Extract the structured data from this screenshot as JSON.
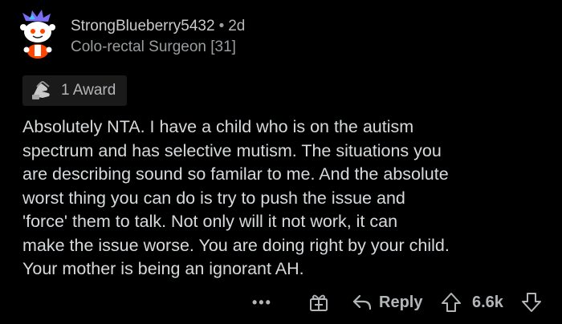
{
  "comment": {
    "username": "StrongBlueberry5432",
    "separator": "•",
    "age": "2d",
    "flair": "Colo-rectal Surgeon [31]",
    "award_count_label": "1 Award",
    "body_lines": [
      "Absolutely NTA. I have a child who is on the autism",
      "spectrum and has selective mutism. The situations you",
      "are describing sound so familar to me. And the absolute",
      "worst thing you can do is try to push the issue and",
      "'force' them to talk. Not only will it not work, it can",
      "make the issue worse. You are doing right by your child.",
      "Your mother is being an ignorant AH."
    ]
  },
  "actions": {
    "more_label": "•••",
    "reply_label": "Reply",
    "score": "6.6k"
  },
  "icons": {
    "avatar": "snoo-avatar-icon",
    "award": "hands-award-icon",
    "gift": "gift-award-icon",
    "reply": "reply-arrow-icon",
    "upvote": "upvote-arrow-icon",
    "downvote": "downvote-arrow-icon"
  },
  "colors": {
    "background": "#000000",
    "text_primary": "#d7dadc",
    "text_secondary": "#b3b6b8",
    "chip_bg": "#1a1a1b",
    "avatar_accent": "#ff4500",
    "avatar_hair": "#7b6cf6"
  }
}
